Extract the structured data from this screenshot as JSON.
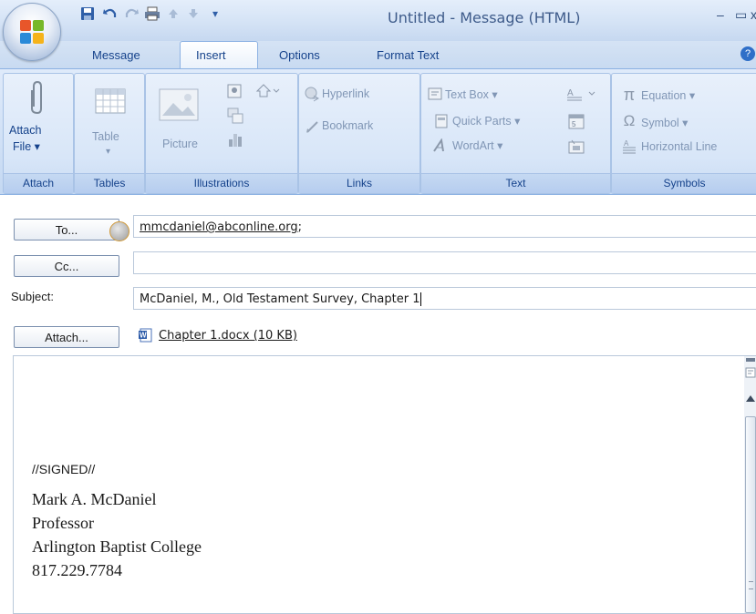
{
  "window": {
    "title": "Untitled - Message (HTML)",
    "minimize": "–",
    "maximize": "▭",
    "close": "x"
  },
  "tabs": [
    {
      "label": "Message"
    },
    {
      "label": "Insert"
    },
    {
      "label": "Options"
    },
    {
      "label": "Format Text"
    }
  ],
  "ribbon": {
    "attach_file": {
      "line1": "Attach",
      "line2": "File ▾"
    },
    "table": {
      "label": "Table",
      "arrow": "▾"
    },
    "picture": {
      "label": "Picture"
    },
    "hyperlink": "Hyperlink",
    "bookmark": "Bookmark",
    "text_box": "Text Box ▾",
    "quick_parts": "Quick Parts ▾",
    "wordart": "WordArt ▾",
    "equation": "Equation ▾",
    "symbol": "Symbol ▾",
    "horizontal_line": "Horizontal Line",
    "groups": {
      "attach": "Attach",
      "tables": "Tables",
      "illustrations": "Illustrations",
      "links": "Links",
      "text": "Text",
      "symbols": "Symbols"
    }
  },
  "header": {
    "to_button": "To...",
    "to_value": "mmcdaniel@abconline.org",
    "to_separator": ";",
    "cc_button": "Cc...",
    "cc_value": "",
    "subject_label": "Subject:",
    "subject_value": "McDaniel, M., Old Testament Survey, Chapter 1",
    "attach_button": "Attach...",
    "attachment": "Chapter 1.docx (10 KB)"
  },
  "body": {
    "signed": "//SIGNED//",
    "name": "Mark A. McDaniel",
    "title": "Professor",
    "org": "Arlington Baptist College",
    "phone": "817.229.7784"
  },
  "colors": {
    "ribbon_text": "#15428b",
    "ribbon_bg": "#d1e1f6"
  }
}
